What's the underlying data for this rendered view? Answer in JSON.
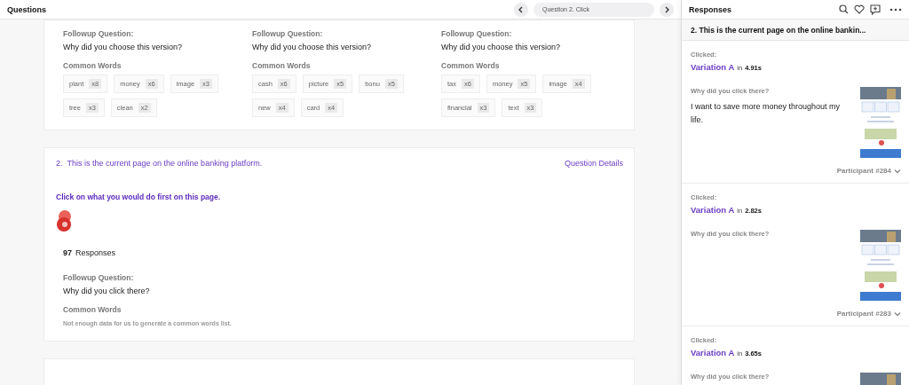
{
  "questions_panel": {
    "title": "Questions",
    "nav": {
      "label": "Question 2. Click"
    }
  },
  "previous_question": {
    "columns": [
      {
        "followup_label": "Followup Question:",
        "followup": "Why did you choose this version?",
        "words_label": "Common Words",
        "words": [
          {
            "word": "plant",
            "count": "x8"
          },
          {
            "word": "money",
            "count": "x6"
          },
          {
            "word": "image",
            "count": "x3"
          },
          {
            "word": "tree",
            "count": "x3"
          },
          {
            "word": "clean",
            "count": "x2"
          }
        ]
      },
      {
        "followup_label": "Followup Question:",
        "followup": "Why did you choose this version?",
        "words_label": "Common Words",
        "words": [
          {
            "word": "cash",
            "count": "x6"
          },
          {
            "word": "picture",
            "count": "x5"
          },
          {
            "word": "bonu",
            "count": "x5"
          },
          {
            "word": "new",
            "count": "x4"
          },
          {
            "word": "card",
            "count": "x4"
          }
        ]
      },
      {
        "followup_label": "Followup Question:",
        "followup": "Why did you choose this version?",
        "words_label": "Common Words",
        "words": [
          {
            "word": "tax",
            "count": "x6"
          },
          {
            "word": "money",
            "count": "x5"
          },
          {
            "word": "image",
            "count": "x4"
          },
          {
            "word": "financial",
            "count": "x3"
          },
          {
            "word": "text",
            "count": "x3"
          }
        ]
      }
    ]
  },
  "question": {
    "number": "2.",
    "title": "This is the current page on the online banking platform.",
    "details_link": "Question Details",
    "prompt": "Click on what you would do first on this page.",
    "responses_count": "97",
    "responses_label": "Responses",
    "followup_label": "Followup Question:",
    "followup": "Why did you click there?",
    "words_label": "Common Words",
    "words_note": "Not enough data for us to generate a common words list."
  },
  "responses_panel": {
    "title": "Responses",
    "question_title": "2. This is the current page on the online bankin...",
    "responses": [
      {
        "clicked_label": "Clicked:",
        "variation": "Variation A",
        "in_label": "in",
        "time": "4.91s",
        "question": "Why did you click there?",
        "answer": "I want to save more money throughout my life.",
        "participant": "Participant #284"
      },
      {
        "clicked_label": "Clicked:",
        "variation": "Variation A",
        "in_label": "in",
        "time": "2.82s",
        "question": "Why did you click there?",
        "participant": "Participant #283"
      },
      {
        "clicked_label": "Clicked:",
        "variation": "Variation A",
        "in_label": "in",
        "time": "3.65s",
        "question": "Why did you click there?"
      }
    ]
  }
}
